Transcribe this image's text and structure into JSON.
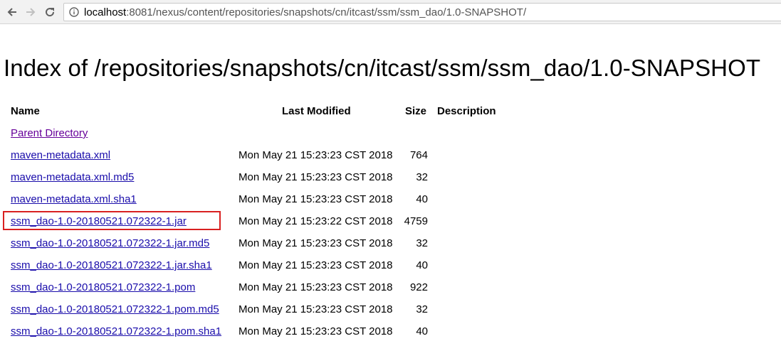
{
  "browser": {
    "url_host": "localhost",
    "url_rest": ":8081/nexus/content/repositories/snapshots/cn/itcast/ssm/ssm_dao/1.0-SNAPSHOT/"
  },
  "page": {
    "title": "Index of /repositories/snapshots/cn/itcast/ssm/ssm_dao/1.0-SNAPSHOT",
    "headers": {
      "name": "Name",
      "modified": "Last Modified",
      "size": "Size",
      "description": "Description"
    },
    "parent": {
      "name": "Parent Directory"
    },
    "files": [
      {
        "name": "maven-metadata.xml",
        "modified": "Mon May 21 15:23:23 CST 2018",
        "size": "764"
      },
      {
        "name": "maven-metadata.xml.md5",
        "modified": "Mon May 21 15:23:23 CST 2018",
        "size": "32"
      },
      {
        "name": "maven-metadata.xml.sha1",
        "modified": "Mon May 21 15:23:23 CST 2018",
        "size": "40"
      },
      {
        "name": "ssm_dao-1.0-20180521.072322-1.jar",
        "modified": "Mon May 21 15:23:22 CST 2018",
        "size": "4759"
      },
      {
        "name": "ssm_dao-1.0-20180521.072322-1.jar.md5",
        "modified": "Mon May 21 15:23:23 CST 2018",
        "size": "32"
      },
      {
        "name": "ssm_dao-1.0-20180521.072322-1.jar.sha1",
        "modified": "Mon May 21 15:23:23 CST 2018",
        "size": "40"
      },
      {
        "name": "ssm_dao-1.0-20180521.072322-1.pom",
        "modified": "Mon May 21 15:23:23 CST 2018",
        "size": "922"
      },
      {
        "name": "ssm_dao-1.0-20180521.072322-1.pom.md5",
        "modified": "Mon May 21 15:23:23 CST 2018",
        "size": "32"
      },
      {
        "name": "ssm_dao-1.0-20180521.072322-1.pom.sha1",
        "modified": "Mon May 21 15:23:23 CST 2018",
        "size": "40"
      }
    ]
  },
  "colors": {
    "link": "#1a0dab",
    "visited_link": "#660099",
    "highlight_box": "#d92020"
  }
}
